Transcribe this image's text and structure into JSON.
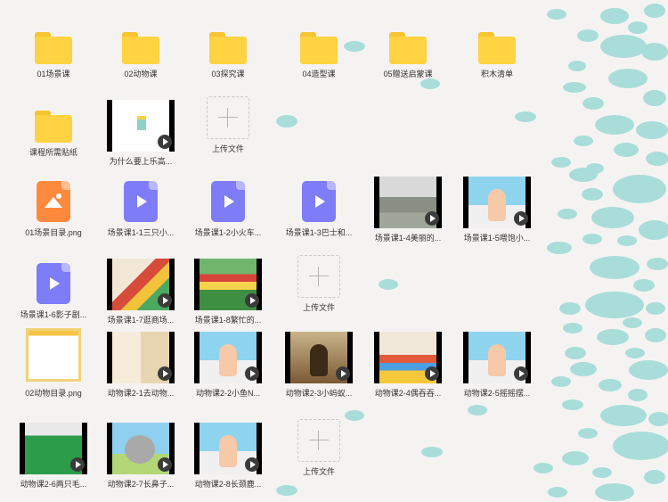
{
  "colors": {
    "background": "#f5f3f2",
    "dots": "#a9ddd9",
    "folder": "#ffd342",
    "video_file": "#7e7cf7",
    "png_file": "#ff8a3d"
  },
  "rows": [
    [
      {
        "kind": "folder",
        "label": "01场景课",
        "icon": "folder-icon"
      },
      {
        "kind": "folder",
        "label": "02动物课",
        "icon": "folder-icon"
      },
      {
        "kind": "folder",
        "label": "03探究课",
        "icon": "folder-icon"
      },
      {
        "kind": "folder",
        "label": "04造型课",
        "icon": "folder-icon"
      },
      {
        "kind": "folder",
        "label": "05赠送启蒙课",
        "icon": "folder-icon"
      },
      {
        "kind": "folder",
        "label": "积木清单",
        "icon": "folder-icon"
      }
    ],
    [
      {
        "kind": "folder",
        "label": "课程所需贴纸",
        "icon": "folder-icon"
      },
      {
        "kind": "video",
        "label": "为什么要上乐高...",
        "scene": "white"
      },
      {
        "kind": "upload",
        "label": "上传文件",
        "icon": "plus-icon"
      }
    ],
    [
      {
        "kind": "png",
        "label": "01场景目录.png",
        "icon": "image-file-icon"
      },
      {
        "kind": "vfile",
        "label": "场景课1-1三只小...",
        "icon": "video-file-icon"
      },
      {
        "kind": "vfile",
        "label": "场景课1-2小火车...",
        "icon": "video-file-icon"
      },
      {
        "kind": "vfile",
        "label": "场景课1-3巴士和...",
        "icon": "video-file-icon"
      },
      {
        "kind": "video",
        "label": "场景课1-4美丽的...",
        "scene": "building"
      },
      {
        "kind": "video",
        "label": "场景课1-5喂饱小...",
        "scene": "teacher"
      }
    ],
    [
      {
        "kind": "vfile",
        "label": "场景课1-6影子剧...",
        "icon": "video-file-icon"
      },
      {
        "kind": "video",
        "label": "场景课1-7逛商场...",
        "scene": "blocks"
      },
      {
        "kind": "video",
        "label": "场景课1-8繁忙的...",
        "scene": "green"
      },
      {
        "kind": "upload",
        "label": "上传文件",
        "icon": "plus-icon"
      }
    ],
    [
      {
        "kind": "image",
        "label": "02动物目录.png",
        "scene": "catalog"
      },
      {
        "kind": "video",
        "label": "动物课2-1去动物...",
        "scene": "book"
      },
      {
        "kind": "video",
        "label": "动物课2-2小鱼N...",
        "scene": "teacher"
      },
      {
        "kind": "video",
        "label": "动物课2-3小蚂蚁...",
        "scene": "ant"
      },
      {
        "kind": "video",
        "label": "动物课2-4偶吞吞...",
        "scene": "bricks"
      },
      {
        "kind": "video",
        "label": "动物课2-5摇摇摆...",
        "scene": "teacher"
      }
    ],
    [
      {
        "kind": "video",
        "label": "动物课2-6两只毛...",
        "scene": "plate"
      },
      {
        "kind": "video",
        "label": "动物课2-7长鼻子...",
        "scene": "elephant"
      },
      {
        "kind": "video",
        "label": "动物课2-8长颈鹿...",
        "scene": "teacher"
      },
      {
        "kind": "upload",
        "label": "上传文件",
        "icon": "plus-icon"
      }
    ]
  ]
}
